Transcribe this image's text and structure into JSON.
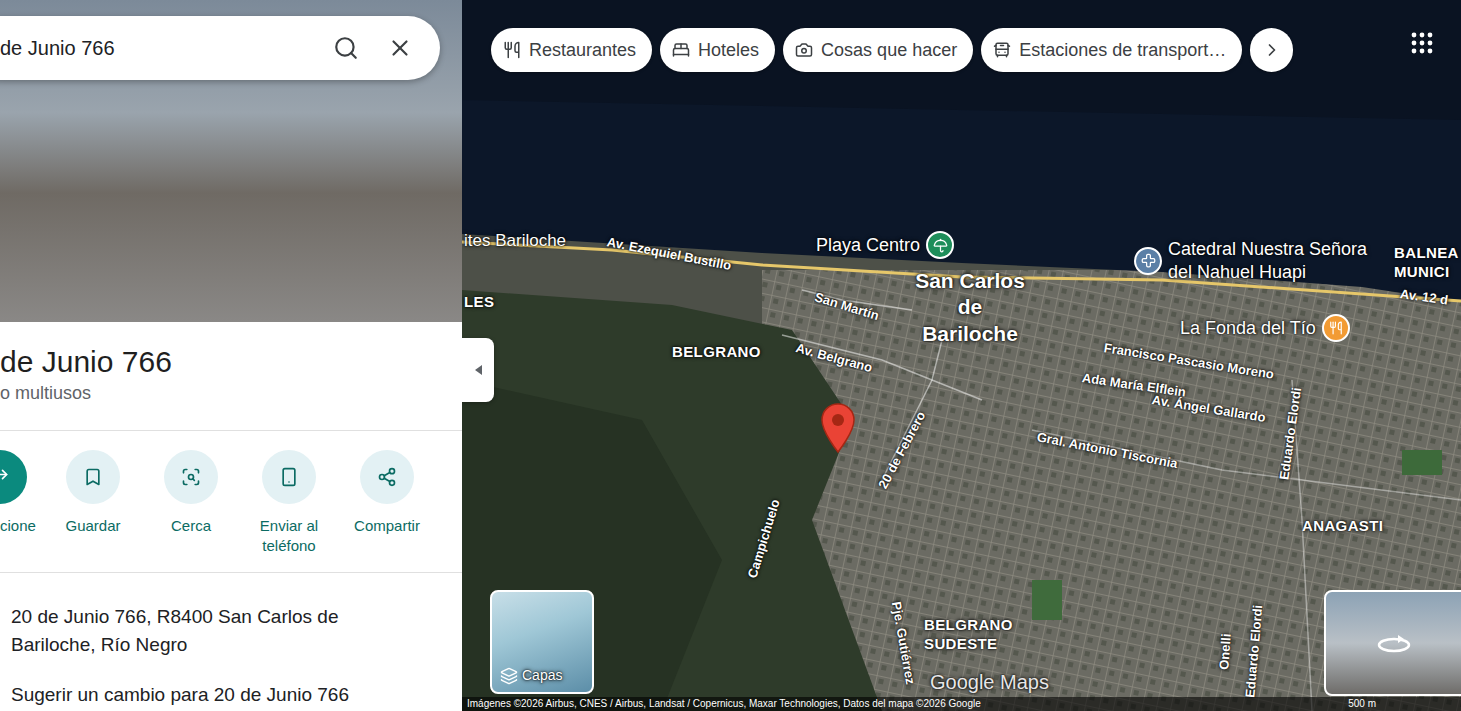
{
  "panel": {
    "search": {
      "value": "de Junio 766"
    },
    "title": "de Junio 766",
    "subtitle": "o multiusos",
    "actions": [
      {
        "label": "cione",
        "kind": "primary"
      },
      {
        "label": "Guardar",
        "kind": "secondary"
      },
      {
        "label": "Cerca",
        "kind": "secondary"
      },
      {
        "label": "Enviar al teléfono",
        "kind": "secondary"
      },
      {
        "label": "Compartir",
        "kind": "secondary"
      }
    ],
    "address": "20 de Junio 766, R8400 San Carlos de Bariloche, Río Negro",
    "suggest": "Sugerir un cambio para 20 de Junio 766"
  },
  "map": {
    "chips": [
      {
        "label": "Restaurantes",
        "kind": "restaurant"
      },
      {
        "label": "Hoteles",
        "kind": "hotel"
      },
      {
        "label": "Cosas que hacer",
        "kind": "camera"
      },
      {
        "label": "Estaciones de transport…",
        "kind": "transit"
      }
    ],
    "labels": [
      {
        "text": "ites Bariloche",
        "kind": "place"
      },
      {
        "text": "Av. Ezequiel Bustillo",
        "kind": "street"
      },
      {
        "text": "Playa Centro",
        "kind": "poi",
        "color": "#1e8e5a"
      },
      {
        "text": "San Carlos de Bariloche",
        "kind": "city"
      },
      {
        "text": "Catedral Nuestra Señora del Nahuel Huapi",
        "kind": "poi",
        "color": "#5b7fa6"
      },
      {
        "text": "BALNEA MUNICI",
        "kind": "area"
      },
      {
        "text": "Av. 12 d",
        "kind": "street"
      },
      {
        "text": "La Fonda del Tío",
        "kind": "poi",
        "color": "#f29b34"
      },
      {
        "text": "Francisco Pascasio Moreno",
        "kind": "street"
      },
      {
        "text": "Ada María Elflein",
        "kind": "street"
      },
      {
        "text": "Av. Ángel Gallardo",
        "kind": "street"
      },
      {
        "text": "Gral. Antonio Tiscornia",
        "kind": "street"
      },
      {
        "text": "Eduardo Elordi",
        "kind": "street"
      },
      {
        "text": "San Martín",
        "kind": "street"
      },
      {
        "text": "Av. Belgrano",
        "kind": "street"
      },
      {
        "text": "BELGRANO",
        "kind": "area"
      },
      {
        "text": "LES",
        "kind": "area"
      },
      {
        "text": "20 de Febrero",
        "kind": "street"
      },
      {
        "text": "Campichuelo",
        "kind": "street"
      },
      {
        "text": "ANAGASTI",
        "kind": "area"
      },
      {
        "text": "BELGRANO SUDESTE",
        "kind": "area"
      },
      {
        "text": "Pje. Gutiérrez",
        "kind": "street"
      },
      {
        "text": "Onelli",
        "kind": "street"
      },
      {
        "text": "Eduardo Elordi",
        "kind": "street"
      }
    ],
    "layers": "Capas",
    "watermark": "Google Maps",
    "attribution": "Imágenes ©2026 Airbus, CNES / Airbus, Landsat / Copernicus, Maxar Technologies, Datos del mapa ©2026 Google",
    "scale": "500 m"
  }
}
